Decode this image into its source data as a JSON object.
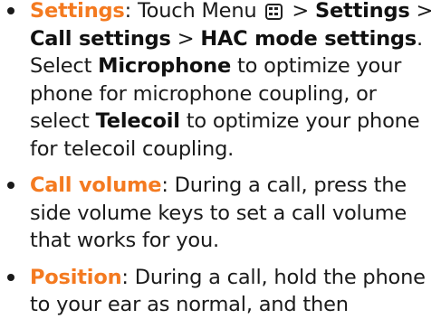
{
  "items": [
    {
      "term": "Settings",
      "t1": ": Touch Menu",
      "icon": "menu-key-icon",
      "t2": ">",
      "b1": "Settings",
      "t3": ">",
      "b2": "Call settings",
      "t4": ">",
      "b3": "HAC mode settings",
      "t5": ". Select",
      "b4": "Microphone",
      "t6": "to optimize your phone for microphone coupling, or select",
      "b5": "Telecoil",
      "t7": "to optimize your phone for telecoil coupling."
    },
    {
      "term": "Call volume",
      "text": ": During a call, press the side volume keys to set a call volume that works for you."
    },
    {
      "term": "Position",
      "text": ": During a call, hold the phone to your ear as normal, and then"
    }
  ],
  "colors": {
    "accent": "#f47a20",
    "text": "#1a1a1a"
  }
}
